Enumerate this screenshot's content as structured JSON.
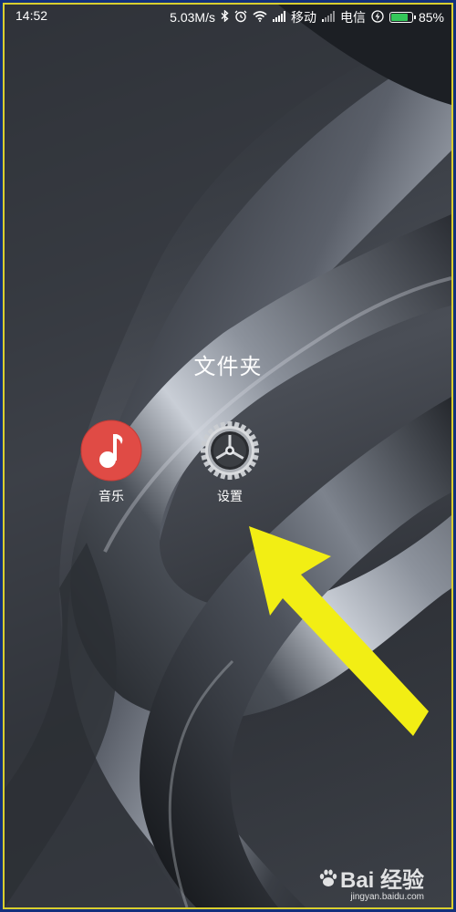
{
  "status_bar": {
    "time": "14:52",
    "net_speed": "5.03M/s",
    "carrier1": "移动",
    "carrier2": "电信",
    "battery": "85%",
    "battery_level": 0.85
  },
  "folder": {
    "title": "文件夹",
    "apps": [
      {
        "label": "音乐",
        "icon": "music-icon"
      },
      {
        "label": "设置",
        "icon": "gear-icon"
      }
    ]
  },
  "watermark": {
    "brand": "Bai  经验",
    "site": "jingyan.baidu.com"
  },
  "colors": {
    "arrow": "#f2ee14",
    "music_red": "#e04b45",
    "battery_green": "#34c85a",
    "border_yellow": "#d9cf2e"
  }
}
